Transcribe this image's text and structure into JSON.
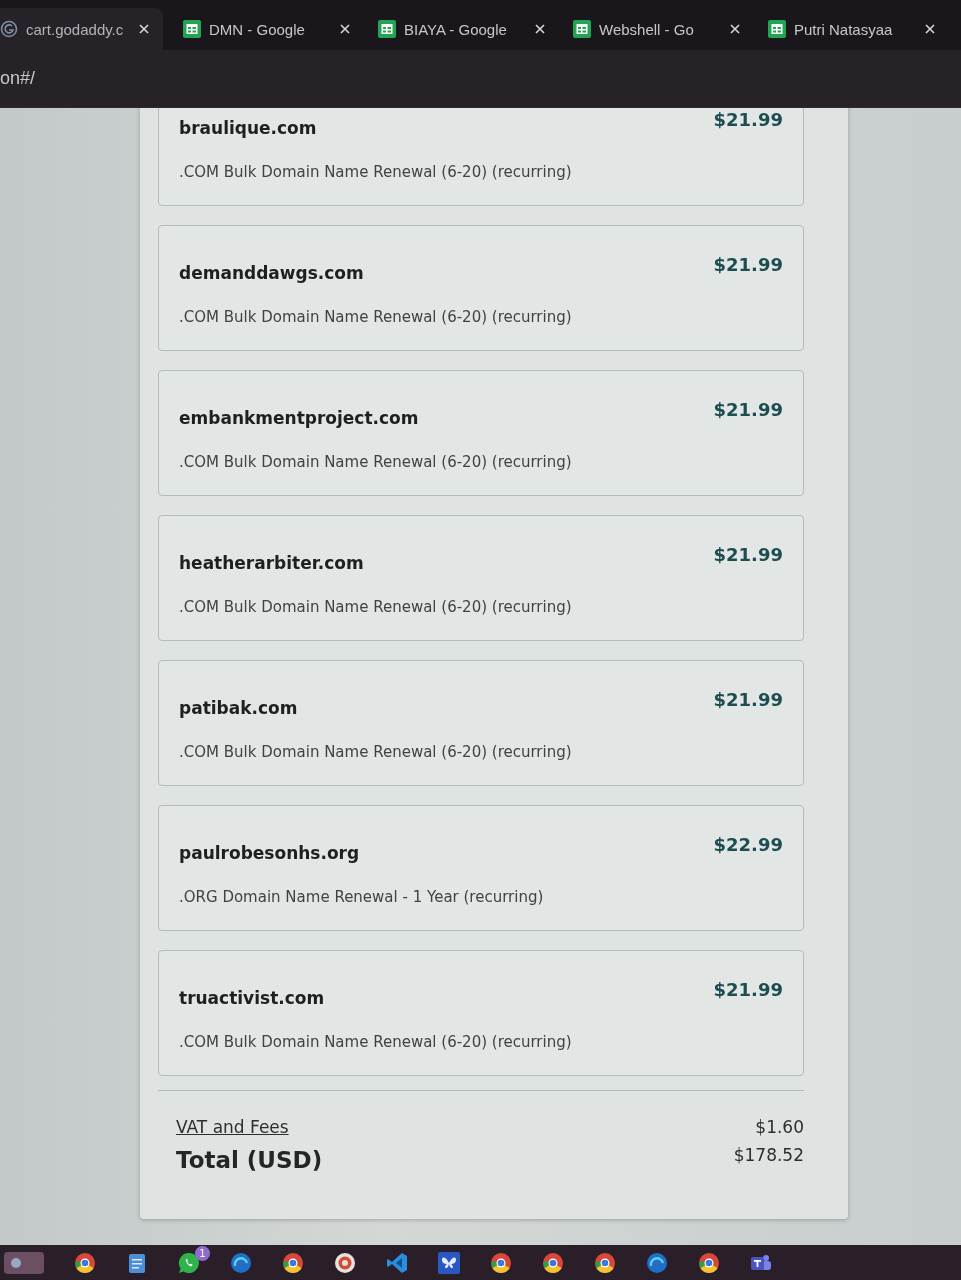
{
  "browser": {
    "tabs": [
      {
        "title": "cart.godaddy.c",
        "kind": "site",
        "selected": true
      },
      {
        "title": "DMN - Google",
        "kind": "sheet",
        "selected": false
      },
      {
        "title": "BIAYA - Google",
        "kind": "sheet",
        "selected": false
      },
      {
        "title": "Webshell - Go",
        "kind": "sheet",
        "selected": false
      },
      {
        "title": "Putri Natasyaa",
        "kind": "sheet",
        "selected": false
      }
    ],
    "address": "on#/"
  },
  "cart": {
    "items": [
      {
        "domain": "braulique.com",
        "price": "$21.99",
        "description": ".COM Bulk Domain Name Renewal (6-20) (recurring)"
      },
      {
        "domain": "demanddawgs.com",
        "price": "$21.99",
        "description": ".COM Bulk Domain Name Renewal (6-20) (recurring)"
      },
      {
        "domain": "embankmentproject.com",
        "price": "$21.99",
        "description": ".COM Bulk Domain Name Renewal (6-20) (recurring)"
      },
      {
        "domain": "heatherarbiter.com",
        "price": "$21.99",
        "description": ".COM Bulk Domain Name Renewal (6-20) (recurring)"
      },
      {
        "domain": "patibak.com",
        "price": "$21.99",
        "description": ".COM Bulk Domain Name Renewal (6-20) (recurring)"
      },
      {
        "domain": "paulrobesonhs.org",
        "price": "$22.99",
        "description": ".ORG Domain Name Renewal - 1 Year (recurring)"
      },
      {
        "domain": "truactivist.com",
        "price": "$21.99",
        "description": ".COM Bulk Domain Name Renewal (6-20) (recurring)"
      }
    ],
    "fees": {
      "label": "VAT and Fees",
      "amount": "$1.60"
    },
    "total": {
      "label": "Total (USD)",
      "amount": "$178.52"
    }
  },
  "taskbar": {
    "badge": "1"
  }
}
